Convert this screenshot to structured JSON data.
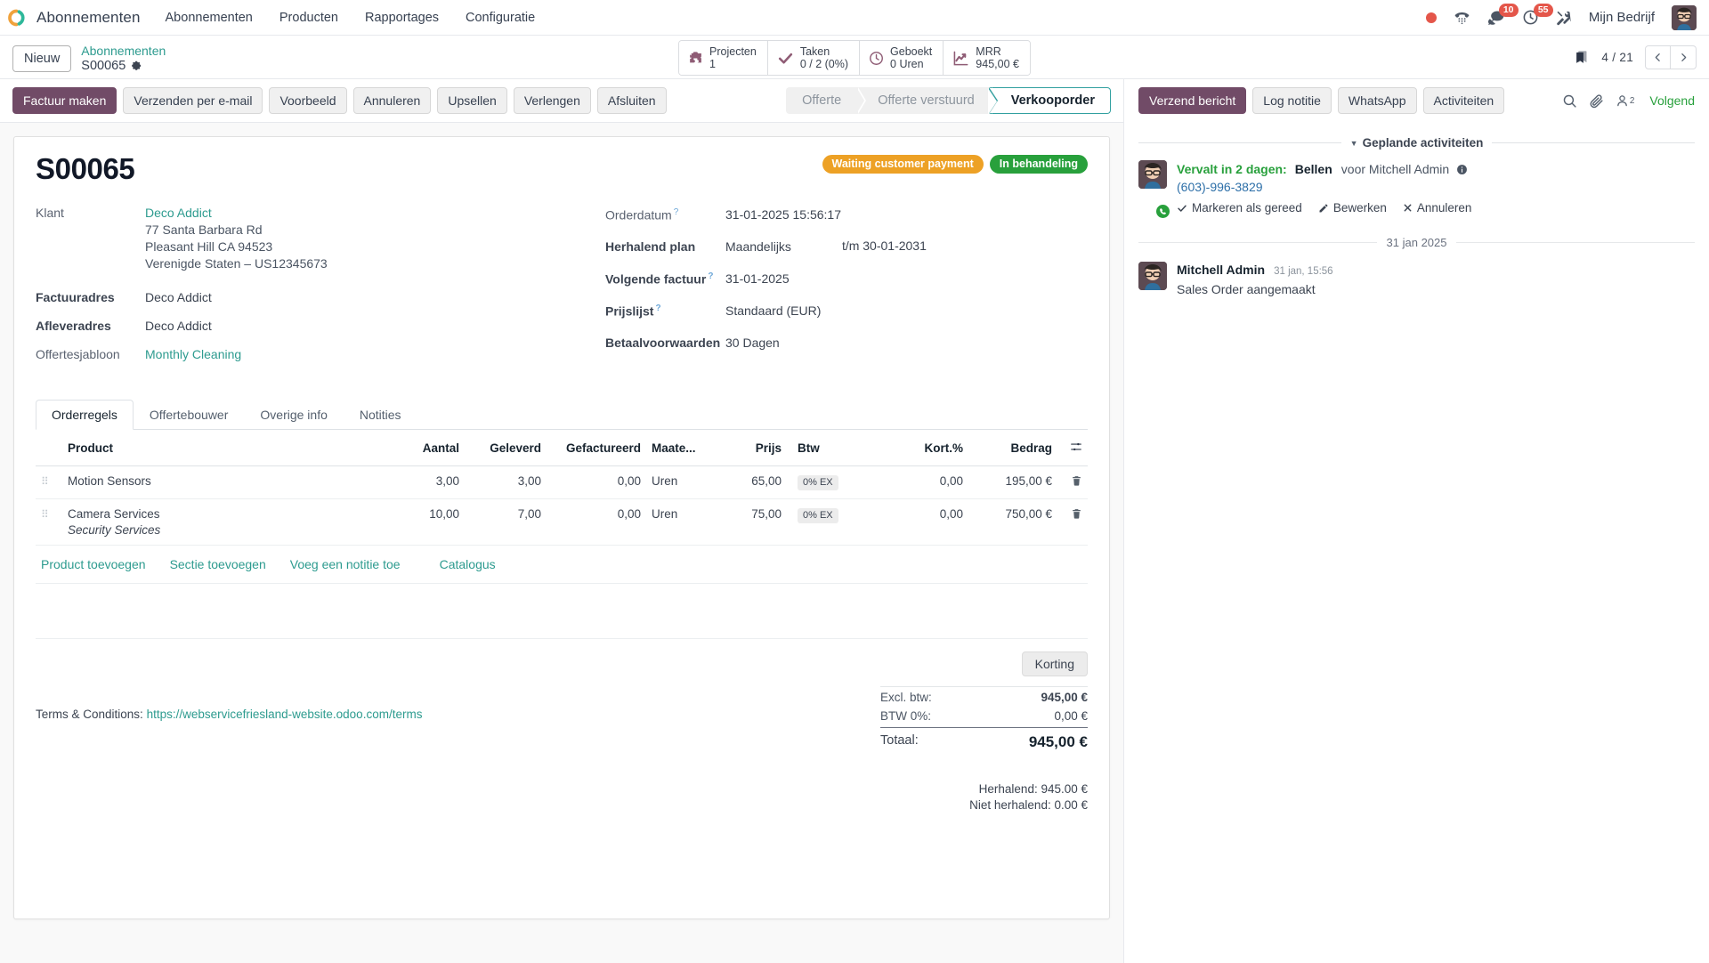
{
  "navbar": {
    "brand": "Abonnementen",
    "menu": [
      "Abonnementen",
      "Producten",
      "Rapportages",
      "Configuratie"
    ],
    "messages_badge": "10",
    "activities_badge": "55",
    "company": "Mijn Bedrijf",
    "icons": {
      "record": "record-dot-icon",
      "dialpad": "dialpad-icon",
      "messages": "messages-icon",
      "activities": "clock-icon",
      "apps": "tools-icon",
      "avatar": "user-avatar"
    }
  },
  "control_panel": {
    "new_label": "Nieuw",
    "breadcrumb_parent": "Abonnementen",
    "breadcrumb_current": "S00065",
    "stats": [
      {
        "icon": "puzzle-icon",
        "label": "Projecten",
        "value": "1"
      },
      {
        "icon": "check-icon",
        "label": "Taken",
        "value": "0 / 2 (0%)"
      },
      {
        "icon": "clock-icon",
        "label": "Geboekt",
        "value": "0 Uren"
      },
      {
        "icon": "trend-chart-icon",
        "label": "MRR",
        "value": "945,00 €"
      }
    ],
    "pager": "4 / 21"
  },
  "action_bar": {
    "buttons": [
      {
        "label": "Factuur maken",
        "primary": true
      },
      {
        "label": "Verzenden per e-mail",
        "primary": false
      },
      {
        "label": "Voorbeeld",
        "primary": false
      },
      {
        "label": "Annuleren",
        "primary": false
      },
      {
        "label": "Upsellen",
        "primary": false
      },
      {
        "label": "Verlengen",
        "primary": false
      },
      {
        "label": "Afsluiten",
        "primary": false
      }
    ],
    "stages": [
      {
        "label": "Offerte",
        "active": false
      },
      {
        "label": "Offerte verstuurd",
        "active": false
      },
      {
        "label": "Verkooporder",
        "active": true
      }
    ]
  },
  "record": {
    "title": "S00065",
    "badges": [
      {
        "label": "Waiting customer payment",
        "color": "#eda125"
      },
      {
        "label": "In behandeling",
        "color": "#28a03c"
      }
    ],
    "left_fields": {
      "customer_label": "Klant",
      "customer_name": "Deco Addict",
      "address": [
        "77 Santa Barbara Rd",
        "Pleasant Hill CA 94523",
        "Verenigde Staten – US12345673"
      ],
      "invoice_address_label": "Factuuradres",
      "invoice_address": "Deco Addict",
      "delivery_address_label": "Afleveradres",
      "delivery_address": "Deco Addict",
      "template_label": "Offertesjabloon",
      "template_value": "Monthly Cleaning"
    },
    "right_fields": [
      {
        "label": "Orderdatum",
        "value": "31-01-2025 15:56:17",
        "help": true,
        "bold": false,
        "extra": ""
      },
      {
        "label": "Herhalend plan",
        "value": "Maandelijks",
        "help": false,
        "bold": true,
        "extra": "t/m  30-01-2031"
      },
      {
        "label": "Volgende factuur",
        "value": "31-01-2025",
        "help": true,
        "bold": true,
        "extra": ""
      },
      {
        "label": "Prijslijst",
        "value": "Standaard (EUR)",
        "help": true,
        "bold": true,
        "extra": ""
      },
      {
        "label": "Betaalvoorwaarden",
        "value": "30 Dagen",
        "help": false,
        "bold": true,
        "extra": ""
      }
    ]
  },
  "notebook": {
    "tabs": [
      {
        "label": "Orderregels",
        "active": true
      },
      {
        "label": "Offertebouwer",
        "active": false
      },
      {
        "label": "Overige info",
        "active": false
      },
      {
        "label": "Notities",
        "active": false
      }
    ],
    "columns": [
      "Product",
      "Aantal",
      "Geleverd",
      "Gefactureerd",
      "Maate...",
      "Prijs",
      "Btw",
      "Kort.%",
      "Bedrag"
    ],
    "rows": [
      {
        "product": "Motion Sensors",
        "description": "",
        "qty": "3,00",
        "delivered": "3,00",
        "invoiced": "0,00",
        "uom": "Uren",
        "price": "65,00",
        "tax": "0% EX",
        "discount": "0,00",
        "amount": "195,00 €"
      },
      {
        "product": "Camera Services",
        "description": "Security Services",
        "qty": "10,00",
        "delivered": "7,00",
        "invoiced": "0,00",
        "uom": "Uren",
        "price": "75,00",
        "tax": "0% EX",
        "discount": "0,00",
        "amount": "750,00 €"
      }
    ],
    "add_links": [
      "Product toevoegen",
      "Sectie toevoegen",
      "Voeg een notitie toe",
      "Catalogus"
    ]
  },
  "footer": {
    "terms_label": "Terms & Conditions:",
    "terms_url": "https://webservicefriesland-website.odoo.com/terms",
    "discount_button": "Korting",
    "totals": [
      {
        "label": "Excl. btw:",
        "value": "945,00 €",
        "kind": "sub"
      },
      {
        "label": "BTW 0%:",
        "value": "0,00 €",
        "kind": "tax"
      },
      {
        "label": "Totaal:",
        "value": "945,00 €",
        "kind": "grand"
      }
    ],
    "recurring": "Herhalend: 945.00 €",
    "non_recurring": "Niet herhalend: 0.00 €"
  },
  "chatter": {
    "buttons": [
      {
        "label": "Verzend bericht",
        "primary": true
      },
      {
        "label": "Log notitie",
        "primary": false
      },
      {
        "label": "WhatsApp",
        "primary": false
      },
      {
        "label": "Activiteiten",
        "primary": false
      }
    ],
    "followers_count": "2",
    "follow_label": "Volgend",
    "activities_title": "Geplande activiteiten",
    "activity": {
      "due": "Vervalt in 2 dagen:",
      "type": "Bellen",
      "assigned": "voor Mitchell Admin",
      "phone": "(603)-996-3829",
      "actions": [
        {
          "icon": "check-icon",
          "label": "Markeren als gereed"
        },
        {
          "icon": "pencil-icon",
          "label": "Bewerken"
        },
        {
          "icon": "cross-icon",
          "label": "Annuleren"
        }
      ]
    },
    "date_separator": "31 jan 2025",
    "message": {
      "author": "Mitchell Admin",
      "time": "31 jan, 15:56",
      "text": "Sales Order aangemaakt"
    }
  }
}
